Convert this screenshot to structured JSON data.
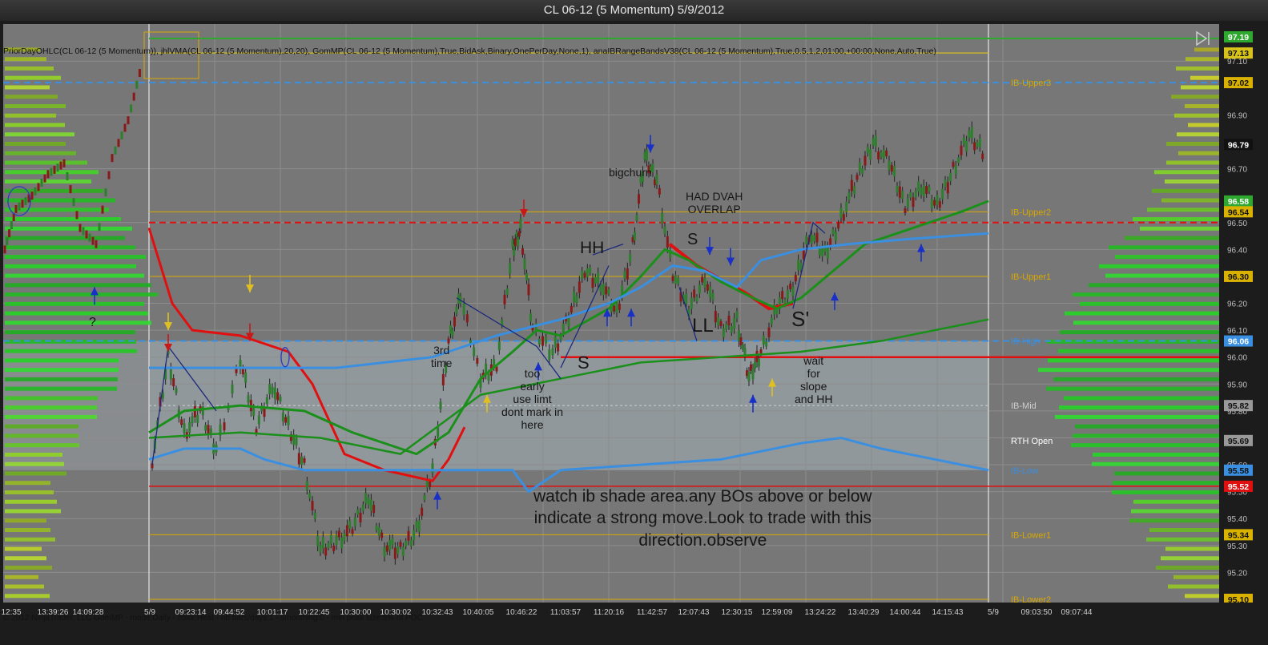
{
  "window": {
    "title": "CL 06-12 (5 Momentum)  5/9/2012"
  },
  "indicators_text": "PriorDayOHLC(CL 06-12 (5 Momentum)), jhlVMA(CL 06-12 (5 Momentum),20,20), GomMP(CL 06-12 (5 Momentum),True,BidAsk,Binary,OnePerDay,None,1), anaIBRangeBandsV38(CL 06-12 (5 Momentum),True,0.5,1,2,01:00,+00:00,None,Auto,True)",
  "footer_text": "© 2012 NinjaTrader, LLC  GomMP - mode:Daily - color:Heat - nb bars/days:1 - smoothing:0 - min peak size:5% of POC",
  "price_axis": {
    "min": 95.1,
    "max": 97.19,
    "ticks": [
      "97.10",
      "96.90",
      "96.70",
      "96.50",
      "96.40",
      "96.20",
      "96.10",
      "96.00",
      "95.90",
      "95.80",
      "95.70",
      "95.60",
      "95.50",
      "95.40",
      "95.30",
      "95.20"
    ],
    "badges": [
      {
        "label": "97.19",
        "color": "#2ea82e",
        "text_color": "#ffffff"
      },
      {
        "label": "97.13",
        "color": "#d6c21a",
        "text_color": "#111111"
      },
      {
        "label": "97.02",
        "color": "#d9b200",
        "text_color": "#111111"
      },
      {
        "label": "96.79",
        "color": "#111111",
        "text_color": "#ffffff"
      },
      {
        "label": "96.58",
        "color": "#2ea82e",
        "text_color": "#ffffff"
      },
      {
        "label": "96.54",
        "color": "#d9b200",
        "text_color": "#111111"
      },
      {
        "label": "96.30",
        "color": "#d9b200",
        "text_color": "#111111"
      },
      {
        "label": "96.06",
        "color": "#3a8fe0",
        "text_color": "#ffffff"
      },
      {
        "label": "95.82",
        "color": "#999999",
        "text_color": "#111111"
      },
      {
        "label": "95.69",
        "color": "#999999",
        "text_color": "#111111"
      },
      {
        "label": "95.58",
        "color": "#3a8fe0",
        "text_color": "#111111"
      },
      {
        "label": "95.52",
        "color": "#e01010",
        "text_color": "#ffffff"
      },
      {
        "label": "95.34",
        "color": "#d9b200",
        "text_color": "#111111"
      },
      {
        "label": "95.10",
        "color": "#d9b200",
        "text_color": "#111111"
      }
    ]
  },
  "time_axis": {
    "labels": [
      "12:35",
      "13:39:26",
      "14:09:28",
      "5/9",
      "09:23:14",
      "09:44:52",
      "10:01:17",
      "10:22:45",
      "10:30:00",
      "10:30:02",
      "10:32:43",
      "10:40:05",
      "10:46:22",
      "11:03:57",
      "11:20:16",
      "11:42:57",
      "12:07:43",
      "12:30:15",
      "12:59:09",
      "13:24:22",
      "13:40:29",
      "14:00:44",
      "14:15:43",
      "5/9",
      "09:03:50",
      "09:07:44"
    ]
  },
  "level_labels": [
    {
      "text": "IB-Upper3",
      "price": 97.02,
      "color": "#d9a800"
    },
    {
      "text": "IB-Upper2",
      "price": 96.54,
      "color": "#d9a800"
    },
    {
      "text": "IB-Upper1",
      "price": 96.3,
      "color": "#d9a800"
    },
    {
      "text": "IB-High",
      "price": 96.06,
      "color": "#3a8fe0"
    },
    {
      "text": "IB-Mid",
      "price": 95.82,
      "color": "#cfcfcf"
    },
    {
      "text": "RTH Open",
      "price": 95.69,
      "color": "#ffffff"
    },
    {
      "text": "IB-Low",
      "price": 95.58,
      "color": "#3a8fe0"
    },
    {
      "text": "IB-Lower1",
      "price": 95.34,
      "color": "#d9a800"
    },
    {
      "text": "IB-Lower2",
      "price": 95.1,
      "color": "#d9a800"
    }
  ],
  "colors": {
    "chart_bg": "#777777",
    "ib_shade": "#a8b4bc",
    "prior_high": "#2ea82e",
    "prior_close": "#e01010",
    "ib_blue": "#3a8fe0",
    "vma": "#1a8f1a",
    "band_red": "#e01010",
    "ib_level": "#d9a800"
  },
  "annotations": {
    "question": "?",
    "third_time": "3rd\ntime",
    "too_early": "too\nearly\nuse limt\ndont mark in\nhere",
    "bigchurn": "bigchurn",
    "had_dvah": "HAD DVAH\nOVERLAP",
    "hh_1": "HH",
    "s_1": "S",
    "s_2": "S",
    "ll": "LL",
    "s_3": "S'",
    "wait": "wait\nfor\nslope\nand HH",
    "note": "watch ib shade area.any BOs above or below\nindicate a strong move.Look to trade with this\ndirection.observe"
  }
}
